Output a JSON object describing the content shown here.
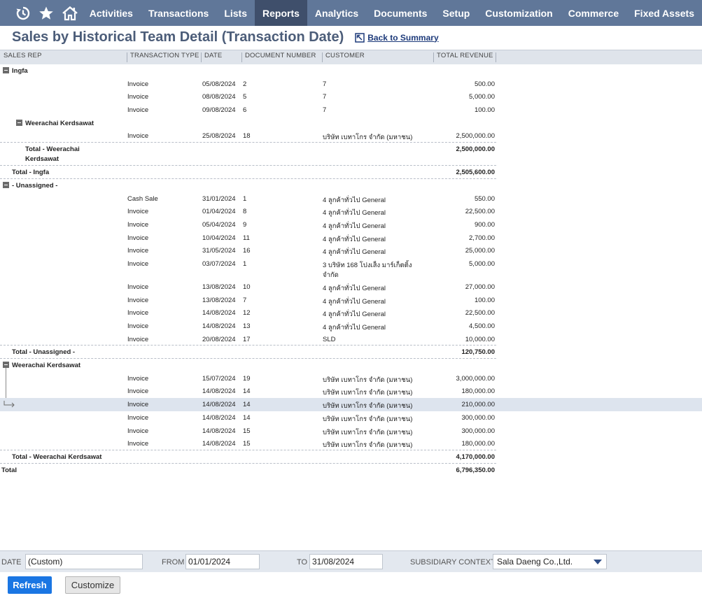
{
  "nav": {
    "icons": [
      "recent-records-icon",
      "favorites-star-icon",
      "home-icon"
    ],
    "items": [
      "Activities",
      "Transactions",
      "Lists",
      "Reports",
      "Analytics",
      "Documents",
      "Setup",
      "Customization",
      "Commerce",
      "Fixed Assets"
    ],
    "active": "Reports"
  },
  "page": {
    "title": "Sales by Historical Team Detail (Transaction Date)",
    "back_label": "Back to Summary"
  },
  "columns": [
    "SALES REP",
    "TRANSACTION TYPE",
    "DATE",
    "DOCUMENT NUMBER",
    "CUSTOMER",
    "TOTAL REVENUE"
  ],
  "rows": [
    {
      "kind": "group",
      "indent": 0,
      "label": "Ingfa"
    },
    {
      "kind": "data",
      "type": "Invoice",
      "date": "05/08/2024",
      "doc": "2",
      "customer": "7",
      "revenue": "500.00"
    },
    {
      "kind": "data",
      "type": "Invoice",
      "date": "08/08/2024",
      "doc": "5",
      "customer": "7",
      "revenue": "5,000.00"
    },
    {
      "kind": "data",
      "type": "Invoice",
      "date": "09/08/2024",
      "doc": "6",
      "customer": "7",
      "revenue": "100.00"
    },
    {
      "kind": "group",
      "indent": 1,
      "label": "Weerachai Kerdsawat"
    },
    {
      "kind": "data",
      "type": "Invoice",
      "date": "25/08/2024",
      "doc": "18",
      "customer": "บริษัท เบทาโกร จำกัด (มหาชน)",
      "revenue": "2,500,000.00",
      "dashed": true
    },
    {
      "kind": "total",
      "indent": 1,
      "label": "Total - Weerachai Kerdsawat",
      "label2": "Kerdsawat",
      "label1": "Total - Weerachai",
      "revenue": "2,500,000.00",
      "tall": true
    },
    {
      "kind": "total",
      "indent": 0,
      "label": "Total - Ingfa",
      "revenue": "2,505,600.00"
    },
    {
      "kind": "group",
      "indent": 0,
      "label": "- Unassigned -"
    },
    {
      "kind": "data",
      "type": "Cash Sale",
      "date": "31/01/2024",
      "doc": "1",
      "customer": "4 ลูกค้าทั่วไป General",
      "revenue": "550.00"
    },
    {
      "kind": "data",
      "type": "Invoice",
      "date": "01/04/2024",
      "doc": "8",
      "customer": "4 ลูกค้าทั่วไป General",
      "revenue": "22,500.00"
    },
    {
      "kind": "data",
      "type": "Invoice",
      "date": "05/04/2024",
      "doc": "9",
      "customer": "4 ลูกค้าทั่วไป General",
      "revenue": "900.00"
    },
    {
      "kind": "data",
      "type": "Invoice",
      "date": "10/04/2024",
      "doc": "11",
      "customer": "4 ลูกค้าทั่วไป General",
      "revenue": "2,700.00"
    },
    {
      "kind": "data",
      "type": "Invoice",
      "date": "31/05/2024",
      "doc": "16",
      "customer": "4 ลูกค้าทั่วไป General",
      "revenue": "25,000.00"
    },
    {
      "kind": "data",
      "type": "Invoice",
      "date": "03/07/2024",
      "doc": "1",
      "customer": "3 บริษัท 168 โปงเส็ง มาร์เก็ตติ้ง",
      "customer2": "จำกัด",
      "revenue": "5,000.00",
      "tall": true
    },
    {
      "kind": "data",
      "type": "Invoice",
      "date": "13/08/2024",
      "doc": "10",
      "customer": "4 ลูกค้าทั่วไป General",
      "revenue": "27,000.00"
    },
    {
      "kind": "data",
      "type": "Invoice",
      "date": "13/08/2024",
      "doc": "7",
      "customer": "4 ลูกค้าทั่วไป General",
      "revenue": "100.00"
    },
    {
      "kind": "data",
      "type": "Invoice",
      "date": "14/08/2024",
      "doc": "12",
      "customer": "4 ลูกค้าทั่วไป General",
      "revenue": "22,500.00"
    },
    {
      "kind": "data",
      "type": "Invoice",
      "date": "14/08/2024",
      "doc": "13",
      "customer": "4 ลูกค้าทั่วไป General",
      "revenue": "4,500.00"
    },
    {
      "kind": "data",
      "type": "Invoice",
      "date": "20/08/2024",
      "doc": "17",
      "customer": "SLD",
      "revenue": "10,000.00",
      "dashed": true
    },
    {
      "kind": "total",
      "indent": 0,
      "label": "Total - Unassigned -",
      "revenue": "120,750.00"
    },
    {
      "kind": "group",
      "indent": 0,
      "label": "Weerachai Kerdsawat"
    },
    {
      "kind": "data",
      "type": "Invoice",
      "date": "15/07/2024",
      "doc": "19",
      "customer": "บริษัท เบทาโกร จำกัด (มหาชน)",
      "revenue": "3,000,000.00"
    },
    {
      "kind": "data",
      "type": "Invoice",
      "date": "14/08/2024",
      "doc": "14",
      "customer": "บริษัท เบทาโกร จำกัด (มหาชน)",
      "revenue": "180,000.00"
    },
    {
      "kind": "data",
      "type": "Invoice",
      "date": "14/08/2024",
      "doc": "14",
      "customer": "บริษัท เบทาโกร จำกัด (มหาชน)",
      "revenue": "210,000.00",
      "highlight": true
    },
    {
      "kind": "data",
      "type": "Invoice",
      "date": "14/08/2024",
      "doc": "14",
      "customer": "บริษัท เบทาโกร จำกัด (มหาชน)",
      "revenue": "300,000.00"
    },
    {
      "kind": "data",
      "type": "Invoice",
      "date": "14/08/2024",
      "doc": "15",
      "customer": "บริษัท เบทาโกร จำกัด (มหาชน)",
      "revenue": "300,000.00"
    },
    {
      "kind": "data",
      "type": "Invoice",
      "date": "14/08/2024",
      "doc": "15",
      "customer": "บริษัท เบทาโกร จำกัด (มหาชน)",
      "revenue": "180,000.00",
      "dashed": true
    },
    {
      "kind": "total",
      "indent": 0,
      "label": "Total - Weerachai Kerdsawat",
      "revenue": "4,170,000.00",
      "dashed": true
    },
    {
      "kind": "grand",
      "indent": -1,
      "label": "Total",
      "revenue": "6,796,350.00"
    }
  ],
  "filters": {
    "date_label": "DATE",
    "date_value": "(Custom)",
    "from_label": "FROM",
    "from_value": "01/01/2024",
    "to_label": "TO",
    "to_value": "31/08/2024",
    "subsidiary_label": "SUBSIDIARY CONTEXT",
    "subsidiary_value": "Sala Daeng Co.,Ltd."
  },
  "buttons": {
    "refresh": "Refresh",
    "customize": "Customize"
  },
  "colors": {
    "nav_bg": "#607799",
    "nav_active": "#3f4f6b",
    "title": "#4c5d79",
    "header_bg": "#dfe4eb",
    "highlight_row": "#dde4ee",
    "refresh_button": "#1a76e3"
  }
}
